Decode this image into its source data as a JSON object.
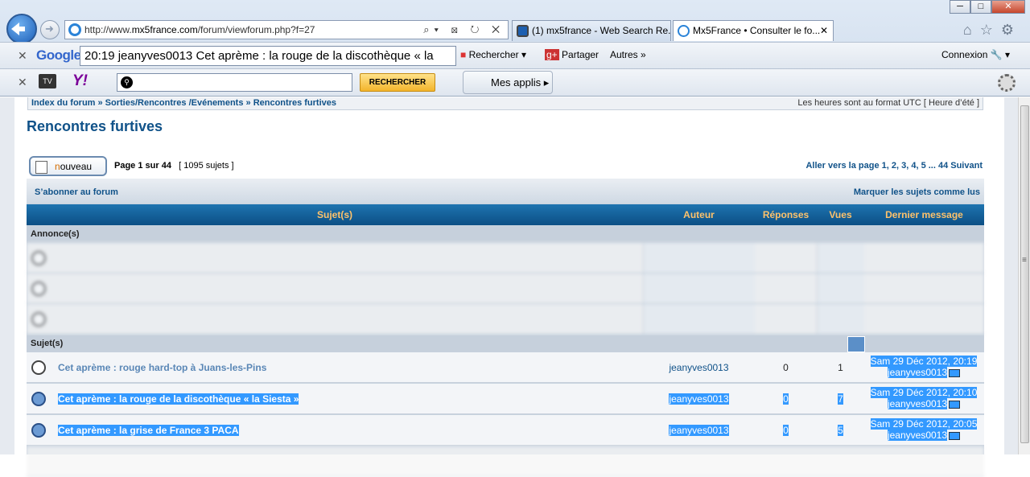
{
  "browser": {
    "url_prefix": "http://www.",
    "url_domain": "mx5france.com",
    "url_path": "/forum/viewforum.php?f=27",
    "tabs": [
      {
        "label": "(1) mx5france - Web Search Re..."
      },
      {
        "label": "Mx5France • Consulter le fo..."
      }
    ]
  },
  "google_bar": {
    "logo": "Google",
    "query": "20:19 jeanyves0013 Cet aprème : la rouge de la discothèque « la",
    "search_label": "Rechercher",
    "share_label": "Partager",
    "more_label": "Autres",
    "login_label": "Connexion"
  },
  "yahoo_bar": {
    "tv": "TV",
    "logo": "Y!",
    "search_button": "RECHERCHER",
    "apps_label": "Mes applis"
  },
  "forum": {
    "breadcrumb": "Index du forum » Sorties/Rencontres /Evénements » Rencontres furtives",
    "timezone": "Les heures sont au format UTC [ Heure d’été ]",
    "title": "Rencontres furtives",
    "new_button_accent": "n",
    "new_button_rest": "ouveau",
    "page_info": "Page 1 sur 44",
    "topic_count": "[ 1095 sujets ]",
    "pagination": "Aller vers la page 1, 2, 3, 4, 5 ... 44  Suivant",
    "subscribe": "S’abonner au forum",
    "mark_read": "Marquer les sujets comme lus",
    "columns": {
      "subject": "Sujet(s)",
      "author": "Auteur",
      "replies": "Réponses",
      "views": "Vues",
      "last": "Dernier message"
    },
    "announcements_label": "Annonce(s)",
    "topics_label": "Sujet(s)",
    "topics": [
      {
        "title": "Cet aprème : rouge hard-top à Juans-les-Pins",
        "author": "jeanyves0013",
        "replies": "0",
        "views": "1",
        "last_date": "Sam 29 Déc 2012, 20:19",
        "last_user": "jeanyves0013"
      },
      {
        "title": "Cet aprème : la rouge de la discothèque « la Siesta »",
        "author": "jeanyves0013",
        "replies": "0",
        "views": "7",
        "last_date": "Sam 29 Déc 2012, 20:10",
        "last_user": "jeanyves0013"
      },
      {
        "title": "Cet aprème : la grise de France 3 PACA",
        "author": "jeanyves0013",
        "replies": "0",
        "views": "5",
        "last_date": "Sam 29 Déc 2012, 20:05",
        "last_user": "jeanyves0013"
      }
    ]
  }
}
